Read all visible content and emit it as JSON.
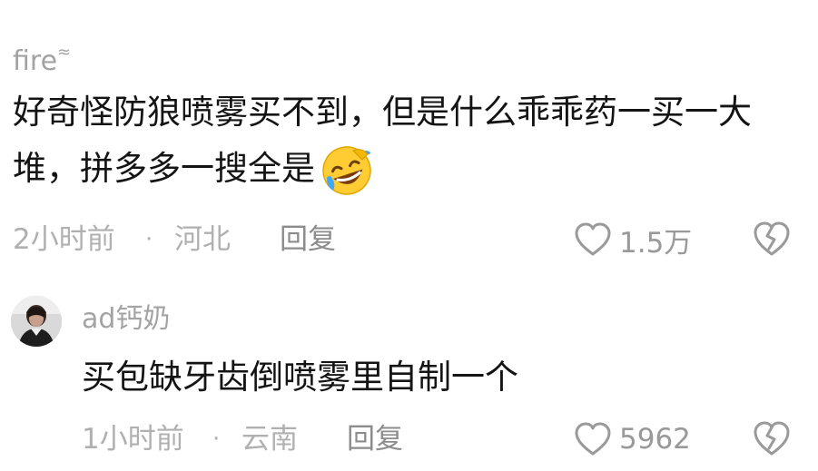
{
  "comments": [
    {
      "username": "fire",
      "username_badge": "≈",
      "text": "好奇怪防狼喷雾买不到，但是什么乖乖药一买一大堆，拼多多一搜全是",
      "emoji": "rofl-crying-emoji",
      "time": "2小时前",
      "separator": "·",
      "location": "河北",
      "reply_label": "回复",
      "like_count": "1.5万"
    },
    {
      "username": "ad钙奶",
      "text": "买包缺牙齿倒喷雾里自制一个",
      "time": "1小时前",
      "separator": "·",
      "location": "云南",
      "reply_label": "回复",
      "like_count": "5962"
    }
  ],
  "icons": {
    "like": "heart-outline-icon",
    "dislike": "broken-heart-icon"
  },
  "colors": {
    "meta_text": "#b0b0b0",
    "username": "#a3a3a3",
    "body_text": "#141414",
    "icon_stroke": "#9a9a9a"
  }
}
